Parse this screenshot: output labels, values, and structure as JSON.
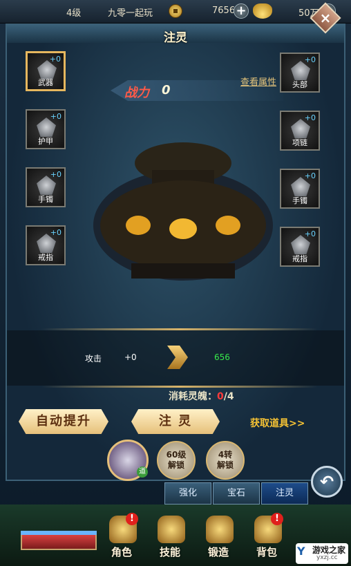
{
  "topbar": {
    "level": "4级",
    "player_name": "九零一起玩",
    "coins": "7656",
    "ingots": "50万"
  },
  "panel": {
    "title": "注灵",
    "close_label": "×",
    "view_attributes": "查看属性",
    "power_label": "战力",
    "power_value": "0"
  },
  "slots": {
    "left": [
      {
        "name": "武器",
        "plus": "+0"
      },
      {
        "name": "护甲",
        "plus": "+0"
      },
      {
        "name": "手镯",
        "plus": "+0"
      },
      {
        "name": "戒指",
        "plus": "+0"
      }
    ],
    "right": [
      {
        "name": "头部",
        "plus": "+0"
      },
      {
        "name": "项链",
        "plus": "+0"
      },
      {
        "name": "手镯",
        "plus": "+0"
      },
      {
        "name": "戒指",
        "plus": "+0"
      }
    ]
  },
  "stats": {
    "attr": "攻击",
    "current": "+0",
    "next": "656"
  },
  "consume": {
    "label": "消耗灵魄：",
    "have": "0",
    "need": "/4"
  },
  "buttons": {
    "auto_upgrade": "自动提升",
    "inject": "注 灵",
    "get_items": "获取道具>>"
  },
  "locks": {
    "lv60": [
      "60级",
      "解锁"
    ],
    "turn4": [
      "4转",
      "解锁"
    ]
  },
  "avatar": {
    "badge": "道"
  },
  "tabs": [
    "强化",
    "宝石",
    "注灵"
  ],
  "nav": [
    "角色",
    "技能",
    "锻造",
    "背包"
  ],
  "watermark": {
    "main": "游戏之家",
    "sub": "yxzj.cc"
  },
  "colors": {
    "power_red": "#ff5a48",
    "stat_green": "#37e84a",
    "gold": "#f5c234"
  }
}
